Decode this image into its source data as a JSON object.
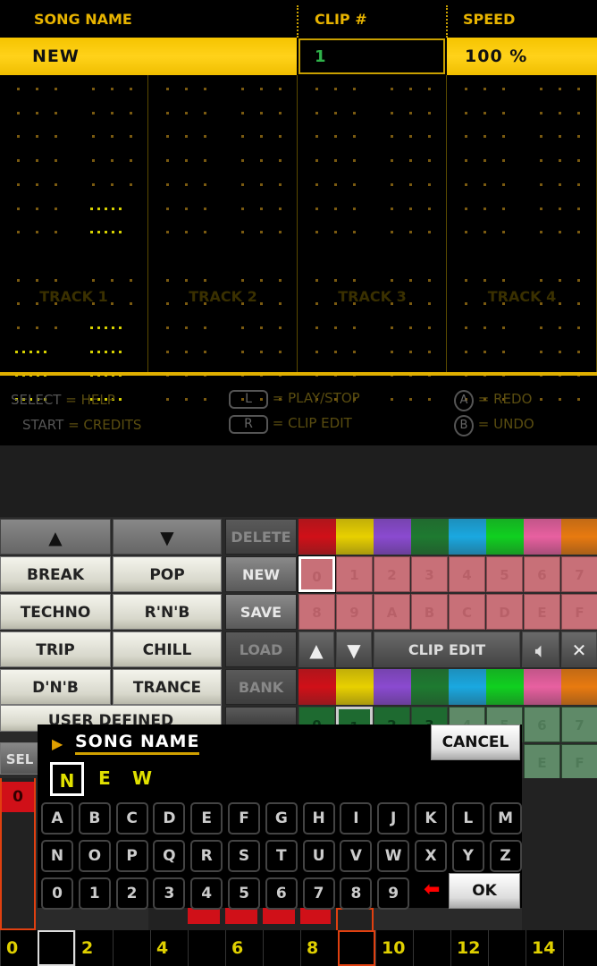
{
  "top_screen": {
    "headers": {
      "song_name": "SONG NAME",
      "clip": "CLIP #",
      "speed": "SPEED"
    },
    "values": {
      "song_name": "NEW",
      "clip": "1",
      "speed": "100 %"
    },
    "tracks": [
      {
        "label": "TRACK 1",
        "active": [
          [
            5,
            "R"
          ],
          [
            6,
            "R"
          ],
          [
            9,
            "R"
          ],
          [
            10,
            "L"
          ],
          [
            10,
            "R"
          ],
          [
            11,
            "L"
          ],
          [
            11,
            "R"
          ],
          [
            12,
            "L"
          ],
          [
            12,
            "R"
          ]
        ]
      },
      {
        "label": "TRACK 2",
        "active": []
      },
      {
        "label": "TRACK 3",
        "active": []
      },
      {
        "label": "TRACK 4",
        "active": []
      }
    ],
    "help": {
      "select": "SELECT",
      "select_action": "= HELP",
      "start": "START",
      "start_action": "= CREDITS",
      "l": "L",
      "l_action": "= PLAY/STOP",
      "r": "R",
      "r_action": "= CLIP EDIT",
      "a": "A",
      "a_action": "= REDO",
      "b": "B",
      "b_action": "= UNDO"
    }
  },
  "bottom_screen": {
    "genres": [
      "BREAK",
      "POP",
      "TECHNO",
      "R'N'B",
      "TRIP",
      "CHILL",
      "D'N'B",
      "TRANCE"
    ],
    "user_defined": "USER DEFINED",
    "side_buttons": [
      "DELETE",
      "NEW",
      "SAVE",
      "LOAD",
      "BANK"
    ],
    "swatch_colors": [
      "#d01018",
      "#e8d000",
      "#8a4ad0",
      "#1e7a30",
      "#1aa8e0",
      "#10d020",
      "#e860a0",
      "#e87a10"
    ],
    "clips_row1": [
      "0",
      "1",
      "2",
      "3",
      "4",
      "5",
      "6",
      "7"
    ],
    "clips_row2": [
      "8",
      "9",
      "A",
      "B",
      "C",
      "D",
      "E",
      "F"
    ],
    "clip_edit": "CLIP EDIT",
    "select_partial": "SEL",
    "timeline": [
      "0",
      "",
      "2",
      "",
      "4",
      "",
      "6",
      "",
      "8",
      "",
      "10",
      "",
      "12",
      "",
      "14",
      ""
    ],
    "dialog": {
      "title": "SONG NAME",
      "name_chars": [
        "N",
        "E",
        "W"
      ],
      "keys": [
        [
          "A",
          "B",
          "C",
          "D",
          "E",
          "F",
          "G",
          "H",
          "I",
          "J",
          "K",
          "L",
          "M"
        ],
        [
          "N",
          "O",
          "P",
          "Q",
          "R",
          "S",
          "T",
          "U",
          "V",
          "W",
          "X",
          "Y",
          "Z"
        ],
        [
          "0",
          "1",
          "2",
          "3",
          "4",
          "5",
          "6",
          "7",
          "8",
          "9"
        ]
      ],
      "cancel": "CANCEL",
      "ok": "OK"
    }
  }
}
